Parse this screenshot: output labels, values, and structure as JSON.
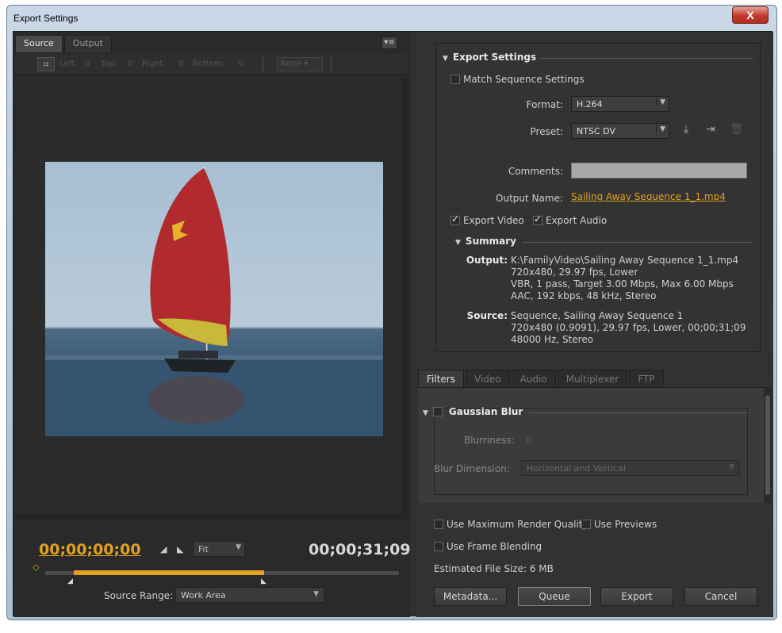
{
  "window": {
    "title": "Export Settings",
    "close_symbol": "X"
  },
  "left": {
    "tabs": [
      "Source",
      "Output"
    ],
    "panel_menu_symbol": "▾≡",
    "crop": {
      "left_label": "Left:",
      "left_value": "0",
      "top_label": "Top:",
      "top_value": "0",
      "right_label": "Right:",
      "right_value": "0",
      "bottom_label": "Bottom:",
      "bottom_value": "0",
      "aspect_select": "None"
    },
    "timecode_current": "00;00;00;00",
    "timecode_end": "00;00;31;09",
    "zoom_select": "Fit",
    "source_range_label": "Source Range:",
    "source_range_value": "Work Area"
  },
  "export_settings": {
    "heading": "Export Settings",
    "match_sequence_label": "Match Sequence Settings",
    "format_label": "Format:",
    "format_value": "H.264",
    "preset_label": "Preset:",
    "preset_value": "NTSC DV",
    "comments_label": "Comments:",
    "output_name_label": "Output Name:",
    "output_name_value": "Sailing Away Sequence 1_1.mp4",
    "export_video_label": "Export Video",
    "export_audio_label": "Export Audio",
    "summary_heading": "Summary",
    "output_label": "Output:",
    "output_lines": [
      "K:\\FamilyVideo\\Sailing Away Sequence 1_1.mp4",
      "720x480, 29.97 fps, Lower",
      "VBR, 1 pass, Target 3.00 Mbps, Max 6.00 Mbps",
      "AAC, 192 kbps, 48 kHz, Stereo"
    ],
    "source_label": "Source:",
    "source_lines": [
      "Sequence, Sailing Away Sequence 1",
      "720x480 (0.9091), 29.97 fps, Lower, 00;00;31;09",
      "48000 Hz, Stereo"
    ]
  },
  "filter_tabs": [
    "Filters",
    "Video",
    "Audio",
    "Multiplexer",
    "FTP"
  ],
  "filters": {
    "gaussian_heading": "Gaussian Blur",
    "blurriness_label": "Blurriness:",
    "blurriness_value": "0",
    "blur_dimension_label": "Blur Dimension:",
    "blur_dimension_value": "Horizontal and Vertical"
  },
  "options": {
    "max_render_quality": "Use Maximum Render Quality",
    "use_previews": "Use Previews",
    "frame_blending": "Use Frame Blending",
    "estimated_size": "Estimated File Size:  6 MB"
  },
  "buttons": {
    "metadata": "Metadata...",
    "queue": "Queue",
    "export": "Export",
    "cancel": "Cancel"
  },
  "colors": {
    "accent": "#e0a020",
    "panel": "#323232"
  }
}
